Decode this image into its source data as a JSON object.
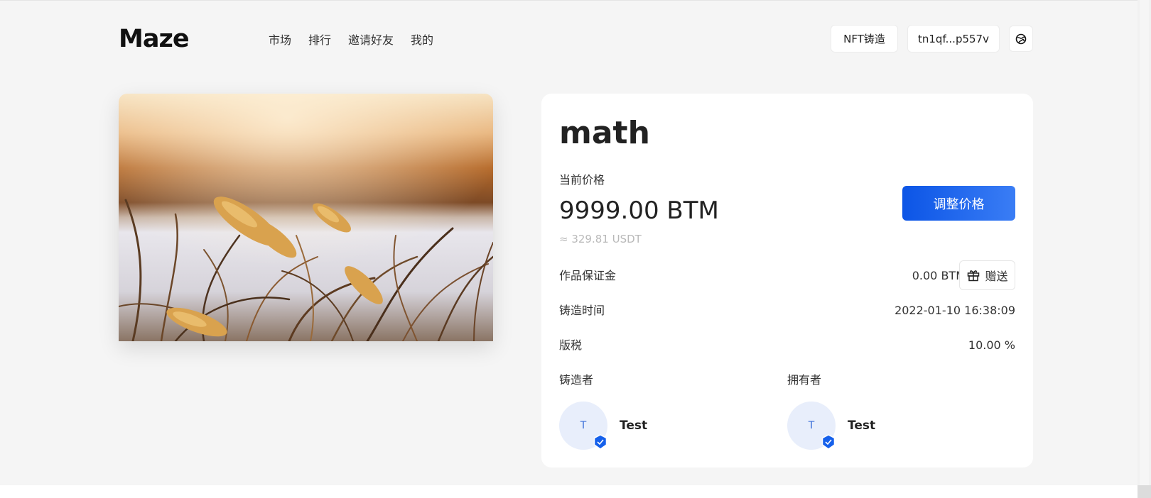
{
  "header": {
    "logo": "Maze",
    "nav": [
      "市场",
      "排行",
      "邀请好友",
      "我的"
    ],
    "mint_button": "NFT铸造",
    "wallet_address": "tn1qf...p557v",
    "lang_icon": "globe-icon"
  },
  "nft": {
    "title": "math",
    "price_label": "当前价格",
    "price": "9999.00 BTM",
    "price_usdt": "≈ 329.81 USDT",
    "adjust_button": "调整价格",
    "deposit_label": "作品保证金",
    "deposit_value": "0.00 BTM",
    "gift_button": "赠送",
    "mint_time_label": "铸造时间",
    "mint_time_value": "2022-01-10 16:38:09",
    "royalty_label": "版税",
    "royalty_value": "10.00 %",
    "creator_label": "铸造者",
    "creator": {
      "initial": "T",
      "name": "Test"
    },
    "owner_label": "拥有者",
    "owner": {
      "initial": "T",
      "name": "Test"
    }
  },
  "colors": {
    "accent": "#1560eb",
    "background": "#f5f5f5",
    "card": "#ffffff",
    "muted_text": "#b9b9b9"
  }
}
